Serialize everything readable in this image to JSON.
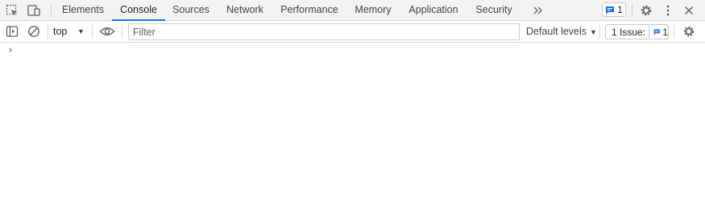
{
  "tabbar": {
    "tabs": [
      {
        "label": "Elements"
      },
      {
        "label": "Console"
      },
      {
        "label": "Sources"
      },
      {
        "label": "Network"
      },
      {
        "label": "Performance"
      },
      {
        "label": "Memory"
      },
      {
        "label": "Application"
      },
      {
        "label": "Security"
      }
    ],
    "active_tab": "Console",
    "overflow_icon": "double-chevron-right-icon",
    "issues_badge": {
      "icon": "message-icon",
      "count": "1"
    },
    "accent_color": "#1a73e8"
  },
  "toolbar": {
    "context": "top",
    "filter": {
      "placeholder": "Filter",
      "value": ""
    },
    "levels_label": "Default levels",
    "issues": {
      "label": "1 Issue:",
      "count": "1"
    }
  },
  "console": {
    "prompt_symbol": "›"
  }
}
